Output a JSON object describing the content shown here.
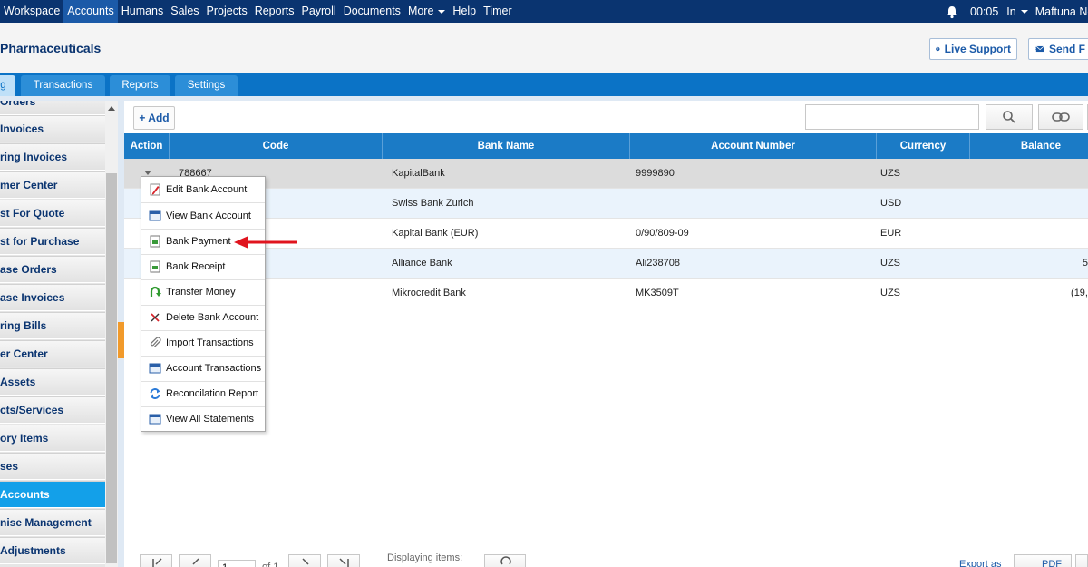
{
  "topnav": {
    "items": [
      {
        "label": "Workspace",
        "active": false
      },
      {
        "label": "Accounts",
        "active": true
      },
      {
        "label": "Humans",
        "active": false
      },
      {
        "label": "Sales",
        "active": false
      },
      {
        "label": "Projects",
        "active": false
      },
      {
        "label": "Reports",
        "active": false
      },
      {
        "label": "Payroll",
        "active": false
      },
      {
        "label": "Documents",
        "active": false
      },
      {
        "label": "More",
        "active": false
      },
      {
        "label": "Help",
        "active": false
      },
      {
        "label": "Timer",
        "active": false
      }
    ],
    "time": "00:05",
    "status": "In",
    "user": "Maftuna Ne"
  },
  "header": {
    "company": "Pharmaceuticals",
    "live_support": "Live Support",
    "send_feedback": "Send F"
  },
  "tabs": [
    {
      "label": "g",
      "active": true
    },
    {
      "label": "Transactions",
      "active": false
    },
    {
      "label": "Reports",
      "active": false
    },
    {
      "label": "Settings",
      "active": false
    }
  ],
  "sidebar": {
    "items": [
      {
        "label": "Orders",
        "active": false
      },
      {
        "label": "Invoices",
        "active": false
      },
      {
        "label": "ring Invoices",
        "active": false
      },
      {
        "label": "mer Center",
        "active": false
      },
      {
        "label": "st For Quote",
        "active": false
      },
      {
        "label": "st for Purchase",
        "active": false
      },
      {
        "label": "ase Orders",
        "active": false
      },
      {
        "label": "ase Invoices",
        "active": false
      },
      {
        "label": "ring Bills",
        "active": false
      },
      {
        "label": "er Center",
        "active": false
      },
      {
        "label": "Assets",
        "active": false
      },
      {
        "label": "cts/Services",
        "active": false
      },
      {
        "label": "ory Items",
        "active": false
      },
      {
        "label": "ses",
        "active": false
      },
      {
        "label": "Accounts",
        "active": true
      },
      {
        "label": "nise Management",
        "active": false
      },
      {
        "label": "Adjustments",
        "active": false
      }
    ]
  },
  "toolbar": {
    "add_label": "+ Add",
    "search_value": ""
  },
  "grid": {
    "columns": [
      "Action",
      "Code",
      "Bank Name",
      "Account Number",
      "Currency",
      "Balance"
    ],
    "rows": [
      {
        "code": "788667",
        "bank": "KapitalBank",
        "account": "9999890",
        "currency": "UZS",
        "balance": ""
      },
      {
        "code": "",
        "bank": "Swiss Bank Zurich",
        "account": "",
        "currency": "USD",
        "balance": ""
      },
      {
        "code": "",
        "bank": "Kapital Bank (EUR)",
        "account": "0/90/809-09",
        "currency": "EUR",
        "balance": ""
      },
      {
        "code": "",
        "bank": "Alliance Bank",
        "account": "Ali238708",
        "currency": "UZS",
        "balance": "5"
      },
      {
        "code": "",
        "bank": "Mikrocredit Bank",
        "account": "MK3509T",
        "currency": "UZS",
        "balance": "(19,"
      }
    ]
  },
  "context_menu": {
    "items": [
      {
        "label": "Edit Bank Account",
        "icon": "edit-icon"
      },
      {
        "label": "View Bank Account",
        "icon": "window-icon"
      },
      {
        "label": "Bank Payment",
        "icon": "document-icon"
      },
      {
        "label": "Bank Receipt",
        "icon": "document-icon"
      },
      {
        "label": "Transfer Money",
        "icon": "transfer-icon"
      },
      {
        "label": "Delete Bank Account",
        "icon": "delete-icon"
      },
      {
        "label": "Import Transactions",
        "icon": "paperclip-icon"
      },
      {
        "label": "Account Transactions",
        "icon": "window-icon"
      },
      {
        "label": "Reconcilation Report",
        "icon": "refresh-icon"
      },
      {
        "label": "View All Statements",
        "icon": "window-icon"
      }
    ]
  },
  "footer": {
    "page_value": "1",
    "of_label": "of",
    "total_pages": "1",
    "displaying_label": "Displaying items:",
    "export_label": "Export as",
    "pdf_label": "PDF"
  },
  "colors": {
    "nav_bg": "#0a3470",
    "tab_bg": "#0b73c6",
    "grid_header": "#1b7bc6",
    "sidebar_active": "#13a0e9",
    "annotation_arrow": "#e0141e"
  }
}
